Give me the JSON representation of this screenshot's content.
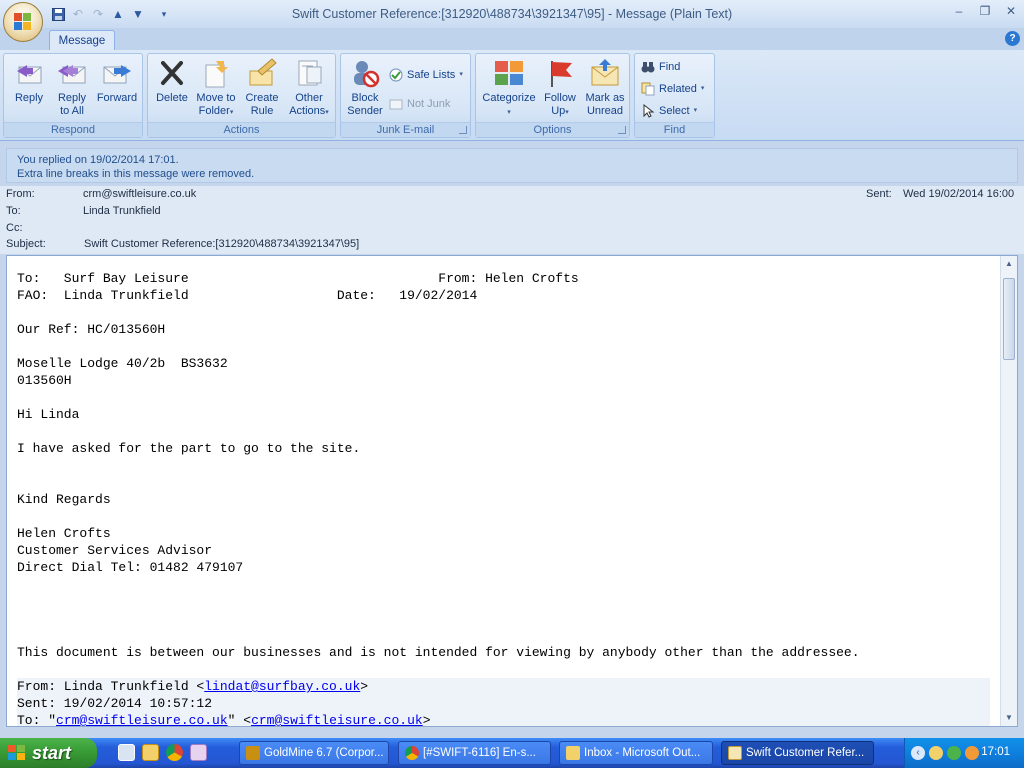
{
  "window": {
    "title": "Swift Customer Reference:[312920\\488734\\3921347\\95] - Message (Plain Text)",
    "controls": {
      "minimize": "‒",
      "restore": "❐",
      "close": "✕"
    }
  },
  "tabs": {
    "message": "Message"
  },
  "ribbon": {
    "respond": {
      "label": "Respond",
      "reply": "Reply",
      "reply_all_line1": "Reply",
      "reply_all_line2": "to All",
      "forward": "Forward"
    },
    "actions": {
      "label": "Actions",
      "delete": "Delete",
      "move_line1": "Move to",
      "move_line2": "Folder",
      "create_line1": "Create",
      "create_line2": "Rule",
      "other_line1": "Other",
      "other_line2": "Actions"
    },
    "junk": {
      "label": "Junk E-mail",
      "block_line1": "Block",
      "block_line2": "Sender",
      "safe_lists": "Safe Lists",
      "not_junk": "Not Junk"
    },
    "options": {
      "label": "Options",
      "categorize": "Categorize",
      "follow_line1": "Follow",
      "follow_line2": "Up",
      "mark_line1": "Mark as",
      "mark_line2": "Unread"
    },
    "find": {
      "label": "Find",
      "find": "Find",
      "related": "Related",
      "select": "Select"
    }
  },
  "infobar": {
    "line1": "You replied on 19/02/2014 17:01.",
    "line2": "Extra line breaks in this message were removed."
  },
  "header": {
    "from_label": "From:",
    "from_value": "crm@swiftleisure.co.uk",
    "to_label": "To:",
    "to_value": "Linda Trunkfield",
    "cc_label": "Cc:",
    "subject_label": "Subject:",
    "subject_value": "Swift Customer Reference:[312920\\488734\\3921347\\95]",
    "sent_label": "Sent:",
    "sent_value": "Wed 19/02/2014 16:00"
  },
  "body": {
    "line_to": "To:   Surf Bay Leisure                                From: Helen Crofts",
    "line_fao": "FAO:  Linda Trunkfield                   Date:   19/02/2014",
    "line_ref": "Our Ref: HC/013560H",
    "line_model": "Moselle Lodge 40/2b  BS3632",
    "line_serial": "013560H",
    "line_greet": "Hi Linda",
    "line_msg": "I have asked for the part to go to the site.",
    "line_regards": "Kind Regards",
    "line_name": "Helen Crofts",
    "line_title": "Customer Services Advisor",
    "line_tel": "Direct Dial Tel: 01482 479107",
    "line_disclaimer": "This document is between our businesses and is not intended for viewing by anybody other than the addressee.",
    "quoted_from_prefix": "From: Linda Trunkfield <",
    "quoted_from_email": "lindat@surfbay.co.uk",
    "quoted_from_suffix": ">",
    "quoted_sent": "Sent: 19/02/2014 10:57:12",
    "quoted_to_prefix": "To: \"",
    "quoted_to_email1": "crm@swiftleisure.co.uk",
    "quoted_to_mid": "\" <",
    "quoted_to_email2": "crm@swiftleisure.co.uk",
    "quoted_to_suffix": ">"
  },
  "taskbar": {
    "start": "start",
    "tasks": [
      "GoldMine 6.7 (Corpor...",
      "[#SWIFT-6116] En-s...",
      "Inbox - Microsoft Out...",
      "Swift Customer Refer..."
    ],
    "clock": "17:01"
  }
}
